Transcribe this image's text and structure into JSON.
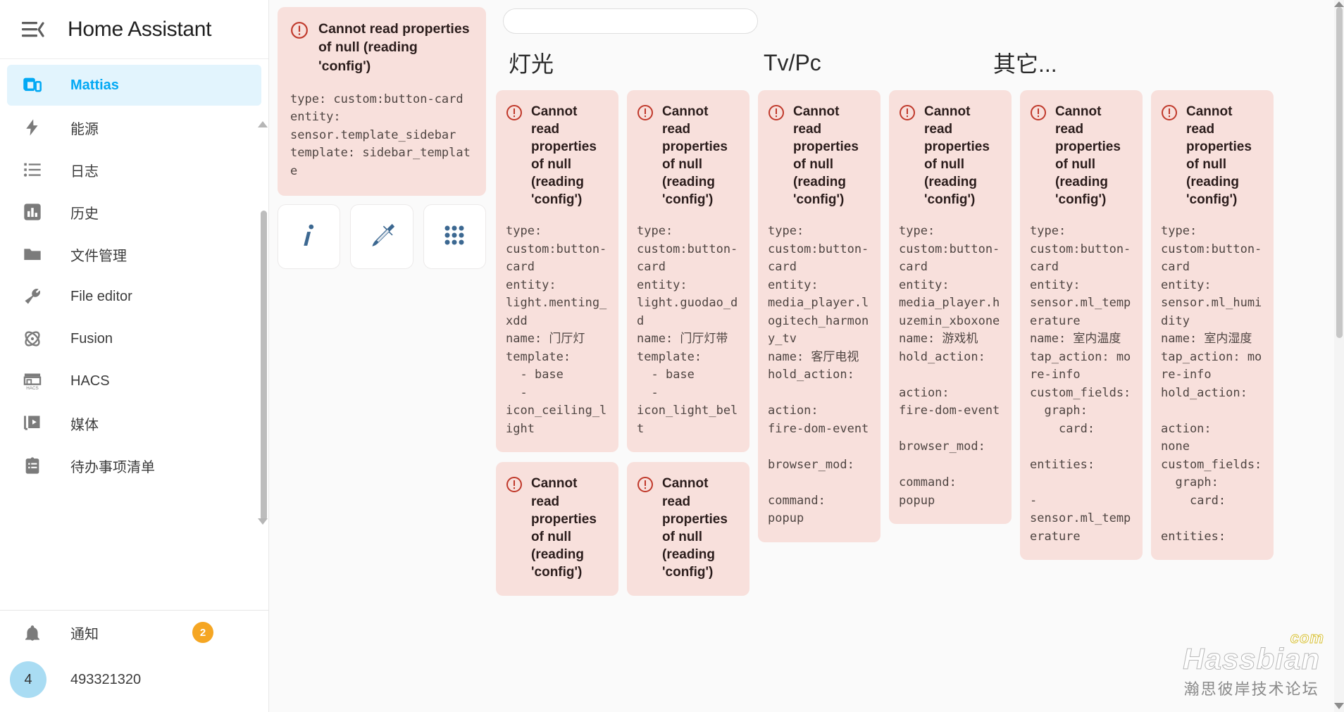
{
  "header": {
    "title": "Home Assistant",
    "toggle_icon": "menu-collapse-icon"
  },
  "sidebar": {
    "items": [
      {
        "label": "Mattias",
        "icon": "tablet-dashboard-icon",
        "active": true
      },
      {
        "label": "能源",
        "icon": "lightning-bolt-icon",
        "active": false
      },
      {
        "label": "日志",
        "icon": "format-list-icon",
        "active": false
      },
      {
        "label": "历史",
        "icon": "chart-box-icon",
        "active": false
      },
      {
        "label": "文件管理",
        "icon": "folder-icon",
        "active": false
      },
      {
        "label": "File editor",
        "icon": "wrench-icon",
        "active": false
      },
      {
        "label": "Fusion",
        "icon": "atom-icon",
        "active": false
      },
      {
        "label": "HACS",
        "icon": "storefront-hacs-icon",
        "active": false
      },
      {
        "label": "媒体",
        "icon": "media-play-icon",
        "active": false
      },
      {
        "label": "待办事项清单",
        "icon": "clipboard-list-icon",
        "active": false
      }
    ],
    "notifications": {
      "label": "通知",
      "icon": "bell-icon",
      "count": "2",
      "badge_color": "#f5a623"
    },
    "user": {
      "name": "493321320",
      "avatar_initial": "4",
      "avatar_color": "#a9dcf3"
    },
    "accent_color": "#03a9f4"
  },
  "main": {
    "search": {
      "value": "",
      "placeholder": ""
    },
    "headings": [
      "灯光",
      "Tv/Pc",
      "其它..."
    ],
    "sidebar_card": {
      "title": "Cannot read properties of null (reading 'config')",
      "yaml": "type: custom:button-card\nentity:\nsensor.template_sidebar\ntemplate: sidebar_template",
      "error_color": "#c0392b",
      "bg_color": "#f8e0dc"
    },
    "quick_buttons": [
      {
        "icon": "info-italic-icon",
        "label": "i"
      },
      {
        "icon": "broom-icon",
        "label": ""
      },
      {
        "icon": "dots-grid-icon",
        "label": ""
      }
    ],
    "error_title": "Cannot read properties of null (reading 'config')",
    "columns": [
      {
        "name": "灯光-col-1",
        "cards": [
          {
            "yaml": "type:\ncustom:button-card\nentity:\nlight.menting_xdd\nname: 门厅灯\ntemplate:\n  - base\n  -\nicon_ceiling_light"
          },
          {
            "yaml": ""
          }
        ]
      },
      {
        "name": "灯光-col-2",
        "cards": [
          {
            "yaml": "type:\ncustom:button-card\nentity:\nlight.guodao_dd\nname: 门厅灯带\ntemplate:\n  - base\n  -\nicon_light_belt"
          },
          {
            "yaml": ""
          }
        ]
      },
      {
        "name": "tvpc-col-1",
        "cards": [
          {
            "yaml": "type:\ncustom:button-card\nentity:\nmedia_player.logitech_harmony_tv\nname: 客厅电视\nhold_action:\n\naction:\nfire-dom-event\n\nbrowser_mod:\n\ncommand:\npopup"
          }
        ]
      },
      {
        "name": "tvpc-col-2",
        "cards": [
          {
            "yaml": "type:\ncustom:button-card\nentity:\nmedia_player.huzemin_xboxone\nname: 游戏机\nhold_action:\n\naction:\nfire-dom-event\n\nbrowser_mod:\n\ncommand:\npopup"
          }
        ]
      },
      {
        "name": "other-col-1",
        "cards": [
          {
            "yaml": "type:\ncustom:button-card\nentity:\nsensor.ml_temperature\nname: 室内温度\ntap_action: more-info\ncustom_fields:\n  graph:\n    card:\n\nentities:\n\n-\nsensor.ml_temperature"
          }
        ]
      },
      {
        "name": "other-col-2",
        "cards": [
          {
            "yaml": "type:\ncustom:button-card\nentity:\nsensor.ml_humidity\nname: 室内湿度\ntap_action: more-info\nhold_action:\n\naction:\nnone\ncustom_fields:\n  graph:\n    card:\n\nentities:"
          }
        ]
      }
    ]
  },
  "watermark": {
    "brand": "Hassbian",
    "tld": "com",
    "subtitle": "瀚思彼岸技术论坛"
  }
}
